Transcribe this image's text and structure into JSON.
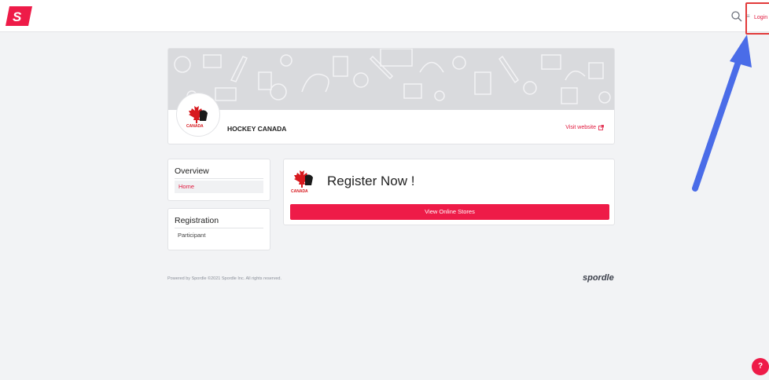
{
  "header": {
    "login_label": "Login",
    "lang_glyph": "≡"
  },
  "organization": {
    "name": "HOCKEY CANADA",
    "visit_label": "Visit website",
    "logo_text": "CANADA"
  },
  "sidebar": {
    "overview": {
      "title": "Overview",
      "items": [
        {
          "label": "Home"
        }
      ]
    },
    "registration": {
      "title": "Registration",
      "items": [
        {
          "label": "Participant"
        }
      ]
    }
  },
  "main": {
    "title": "Register Now !",
    "stores_button": "View Online Stores",
    "logo_text": "CANADA"
  },
  "footer": {
    "copyright": "Powered by Spordle ©2021 Spordle Inc. All rights reserved.",
    "brand": "spordle"
  },
  "help": {
    "label": "?"
  },
  "colors": {
    "accent": "#ee1b48",
    "annotation_arrow": "#4a6ce8",
    "annotation_box": "#e23a3a"
  }
}
